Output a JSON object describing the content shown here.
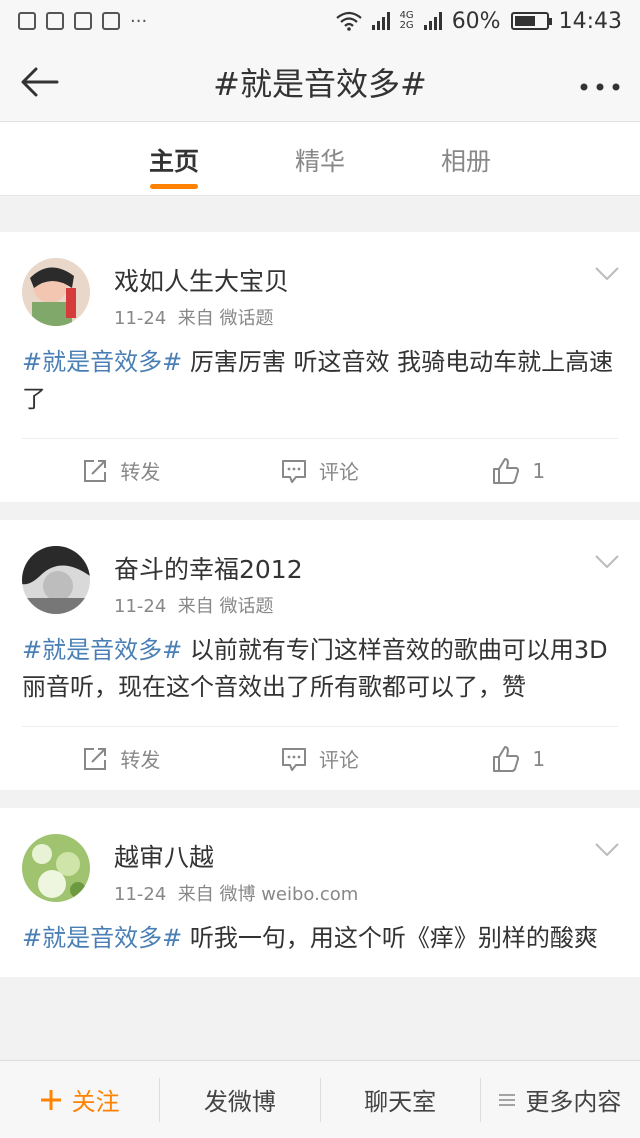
{
  "status_bar": {
    "network_4g": "4G",
    "network_2g": "2G",
    "battery": "60%",
    "time": "14:43",
    "notification_dots": "···"
  },
  "topbar": {
    "title": "#就是音效多#"
  },
  "tabs": [
    {
      "label": "主页",
      "active": true
    },
    {
      "label": "精华",
      "active": false
    },
    {
      "label": "相册",
      "active": false
    }
  ],
  "posts": [
    {
      "username": "戏如人生大宝贝",
      "date": "11-24",
      "source": "来自 微话题",
      "hashtag": "#就是音效多#",
      "text": " 厉害厉害  听这音效  我骑电动车就上高速了",
      "repost_label": "转发",
      "comment_label": "评论",
      "like_count": "1"
    },
    {
      "username": "奋斗的幸福2012",
      "date": "11-24",
      "source": "来自 微话题",
      "hashtag": "#就是音效多#",
      "text": " 以前就有专门这样音效的歌曲可以用3D丽音听，现在这个音效出了所有歌都可以了，赞",
      "repost_label": "转发",
      "comment_label": "评论",
      "like_count": "1"
    },
    {
      "username": "越审八越",
      "date": "11-24",
      "source": "来自 微博 weibo.com",
      "hashtag": "#就是音效多#",
      "text": " 听我一句，用这个听《痒》别样的酸爽"
    }
  ],
  "bottom_bar": {
    "follow": "关注",
    "post": "发微博",
    "chat": "聊天室",
    "more": "更多内容"
  },
  "colors": {
    "accent": "#ff8200",
    "hashtag": "#4a7fb5"
  }
}
